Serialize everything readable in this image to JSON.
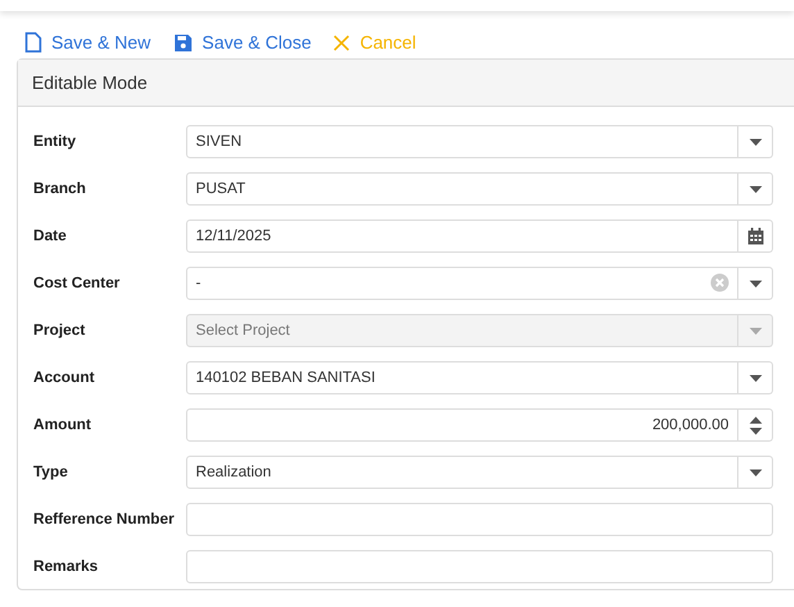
{
  "toolbar": [
    {
      "kind": "new",
      "label": "Save & New"
    },
    {
      "kind": "save",
      "label": "Save & Close"
    },
    {
      "kind": "cancel",
      "label": "Cancel"
    }
  ],
  "panel": {
    "title": "Editable Mode",
    "fields": [
      {
        "label": "Entity",
        "kind": "dropdown",
        "value": "SIVEN",
        "disabled": false,
        "clearable": false
      },
      {
        "label": "Branch",
        "kind": "dropdown",
        "value": "PUSAT",
        "disabled": false,
        "clearable": false
      },
      {
        "label": "Date",
        "kind": "date",
        "value": "12/11/2025",
        "disabled": false,
        "clearable": false
      },
      {
        "label": "Cost Center",
        "kind": "dropdown",
        "value": "-",
        "disabled": false,
        "clearable": true
      },
      {
        "label": "Project",
        "kind": "dropdown",
        "placeholder": "Select Project",
        "disabled": true,
        "clearable": false
      },
      {
        "label": "Account",
        "kind": "dropdown",
        "value": "140102 BEBAN SANITASI",
        "disabled": false,
        "clearable": false
      },
      {
        "label": "Amount",
        "kind": "number",
        "value": "200,000.00",
        "disabled": false,
        "clearable": false
      },
      {
        "label": "Type",
        "kind": "dropdown",
        "value": "Realization",
        "disabled": false,
        "clearable": false
      },
      {
        "label": "Refference Number",
        "kind": "text",
        "disabled": false,
        "clearable": false
      },
      {
        "label": "Remarks",
        "kind": "text",
        "disabled": false,
        "clearable": false
      }
    ]
  }
}
